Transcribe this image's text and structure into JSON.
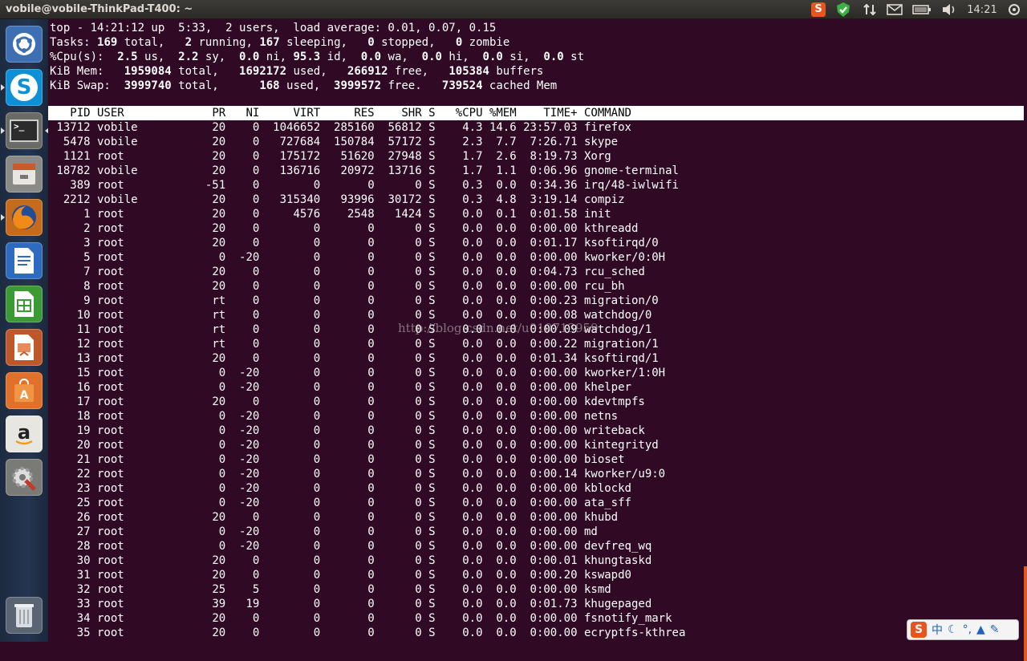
{
  "window": {
    "title": "vobile@vobile-ThinkPad-T400: ~"
  },
  "tray": {
    "clock": "14:21"
  },
  "launcher": {
    "items": [
      "Dash home",
      "Skype",
      "Terminal",
      "Files",
      "Firefox",
      "LibreOffice Writer",
      "LibreOffice Calc",
      "LibreOffice Impress",
      "Ubuntu Software Center",
      "Amazon",
      "System Settings",
      "Trash"
    ]
  },
  "top": {
    "line1": "top - 14:21:12 up  5:33,  2 users,  load average: 0.01, 0.07, 0.15",
    "tasks": {
      "total": "169",
      "running": "2",
      "sleeping": "167",
      "stopped": "0",
      "zombie": "0"
    },
    "cpu": {
      "us": "2.5",
      "sy": "2.2",
      "ni": "0.0",
      "id": "95.3",
      "wa": "0.0",
      "hi": "0.0",
      "si": "0.0",
      "st": "0.0"
    },
    "mem": {
      "total": "1959084",
      "used": "1692172",
      "free": "266912",
      "buffers": "105384"
    },
    "swap": {
      "total": "3999740",
      "used": "168",
      "free": "3999572",
      "cached": "739524"
    },
    "columns": [
      "PID",
      "USER",
      "PR",
      "NI",
      "VIRT",
      "RES",
      "SHR",
      "S",
      "%CPU",
      "%MEM",
      "TIME+",
      "COMMAND"
    ],
    "processes": [
      [
        "13712",
        "vobile",
        "20",
        "0",
        "1046652",
        "285160",
        "56812",
        "S",
        "4.3",
        "14.6",
        "23:57.03",
        "firefox"
      ],
      [
        "5478",
        "vobile",
        "20",
        "0",
        "727684",
        "150784",
        "57172",
        "S",
        "2.3",
        "7.7",
        "7:26.71",
        "skype"
      ],
      [
        "1121",
        "root",
        "20",
        "0",
        "175172",
        "51620",
        "27948",
        "S",
        "1.7",
        "2.6",
        "8:19.73",
        "Xorg"
      ],
      [
        "18782",
        "vobile",
        "20",
        "0",
        "136716",
        "20972",
        "13716",
        "S",
        "1.7",
        "1.1",
        "0:06.96",
        "gnome-terminal"
      ],
      [
        "389",
        "root",
        "-51",
        "0",
        "0",
        "0",
        "0",
        "S",
        "0.3",
        "0.0",
        "0:34.36",
        "irq/48-iwlwifi"
      ],
      [
        "2212",
        "vobile",
        "20",
        "0",
        "315340",
        "93996",
        "30172",
        "S",
        "0.3",
        "4.8",
        "3:19.14",
        "compiz"
      ],
      [
        "1",
        "root",
        "20",
        "0",
        "4576",
        "2548",
        "1424",
        "S",
        "0.0",
        "0.1",
        "0:01.58",
        "init"
      ],
      [
        "2",
        "root",
        "20",
        "0",
        "0",
        "0",
        "0",
        "S",
        "0.0",
        "0.0",
        "0:00.00",
        "kthreadd"
      ],
      [
        "3",
        "root",
        "20",
        "0",
        "0",
        "0",
        "0",
        "S",
        "0.0",
        "0.0",
        "0:01.17",
        "ksoftirqd/0"
      ],
      [
        "5",
        "root",
        "0",
        "-20",
        "0",
        "0",
        "0",
        "S",
        "0.0",
        "0.0",
        "0:00.00",
        "kworker/0:0H"
      ],
      [
        "7",
        "root",
        "20",
        "0",
        "0",
        "0",
        "0",
        "S",
        "0.0",
        "0.0",
        "0:04.73",
        "rcu_sched"
      ],
      [
        "8",
        "root",
        "20",
        "0",
        "0",
        "0",
        "0",
        "S",
        "0.0",
        "0.0",
        "0:00.00",
        "rcu_bh"
      ],
      [
        "9",
        "root",
        "rt",
        "0",
        "0",
        "0",
        "0",
        "S",
        "0.0",
        "0.0",
        "0:00.23",
        "migration/0"
      ],
      [
        "10",
        "root",
        "rt",
        "0",
        "0",
        "0",
        "0",
        "S",
        "0.0",
        "0.0",
        "0:00.08",
        "watchdog/0"
      ],
      [
        "11",
        "root",
        "rt",
        "0",
        "0",
        "0",
        "0",
        "S",
        "0.0",
        "0.0",
        "0:00.09",
        "watchdog/1"
      ],
      [
        "12",
        "root",
        "rt",
        "0",
        "0",
        "0",
        "0",
        "S",
        "0.0",
        "0.0",
        "0:00.22",
        "migration/1"
      ],
      [
        "13",
        "root",
        "20",
        "0",
        "0",
        "0",
        "0",
        "S",
        "0.0",
        "0.0",
        "0:01.34",
        "ksoftirqd/1"
      ],
      [
        "15",
        "root",
        "0",
        "-20",
        "0",
        "0",
        "0",
        "S",
        "0.0",
        "0.0",
        "0:00.00",
        "kworker/1:0H"
      ],
      [
        "16",
        "root",
        "0",
        "-20",
        "0",
        "0",
        "0",
        "S",
        "0.0",
        "0.0",
        "0:00.00",
        "khelper"
      ],
      [
        "17",
        "root",
        "20",
        "0",
        "0",
        "0",
        "0",
        "S",
        "0.0",
        "0.0",
        "0:00.00",
        "kdevtmpfs"
      ],
      [
        "18",
        "root",
        "0",
        "-20",
        "0",
        "0",
        "0",
        "S",
        "0.0",
        "0.0",
        "0:00.00",
        "netns"
      ],
      [
        "19",
        "root",
        "0",
        "-20",
        "0",
        "0",
        "0",
        "S",
        "0.0",
        "0.0",
        "0:00.00",
        "writeback"
      ],
      [
        "20",
        "root",
        "0",
        "-20",
        "0",
        "0",
        "0",
        "S",
        "0.0",
        "0.0",
        "0:00.00",
        "kintegrityd"
      ],
      [
        "21",
        "root",
        "0",
        "-20",
        "0",
        "0",
        "0",
        "S",
        "0.0",
        "0.0",
        "0:00.00",
        "bioset"
      ],
      [
        "22",
        "root",
        "0",
        "-20",
        "0",
        "0",
        "0",
        "S",
        "0.0",
        "0.0",
        "0:00.14",
        "kworker/u9:0"
      ],
      [
        "23",
        "root",
        "0",
        "-20",
        "0",
        "0",
        "0",
        "S",
        "0.0",
        "0.0",
        "0:00.00",
        "kblockd"
      ],
      [
        "25",
        "root",
        "0",
        "-20",
        "0",
        "0",
        "0",
        "S",
        "0.0",
        "0.0",
        "0:00.00",
        "ata_sff"
      ],
      [
        "26",
        "root",
        "20",
        "0",
        "0",
        "0",
        "0",
        "S",
        "0.0",
        "0.0",
        "0:00.00",
        "khubd"
      ],
      [
        "27",
        "root",
        "0",
        "-20",
        "0",
        "0",
        "0",
        "S",
        "0.0",
        "0.0",
        "0:00.00",
        "md"
      ],
      [
        "28",
        "root",
        "0",
        "-20",
        "0",
        "0",
        "0",
        "S",
        "0.0",
        "0.0",
        "0:00.00",
        "devfreq_wq"
      ],
      [
        "30",
        "root",
        "20",
        "0",
        "0",
        "0",
        "0",
        "S",
        "0.0",
        "0.0",
        "0:00.01",
        "khungtaskd"
      ],
      [
        "31",
        "root",
        "20",
        "0",
        "0",
        "0",
        "0",
        "S",
        "0.0",
        "0.0",
        "0:00.20",
        "kswapd0"
      ],
      [
        "32",
        "root",
        "25",
        "5",
        "0",
        "0",
        "0",
        "S",
        "0.0",
        "0.0",
        "0:00.00",
        "ksmd"
      ],
      [
        "33",
        "root",
        "39",
        "19",
        "0",
        "0",
        "0",
        "S",
        "0.0",
        "0.0",
        "0:01.73",
        "khugepaged"
      ],
      [
        "34",
        "root",
        "20",
        "0",
        "0",
        "0",
        "0",
        "S",
        "0.0",
        "0.0",
        "0:00.00",
        "fsnotify_mark"
      ],
      [
        "35",
        "root",
        "20",
        "0",
        "0",
        "0",
        "0",
        "S",
        "0.0",
        "0.0",
        "0:00.00",
        "ecryptfs-kthrea"
      ]
    ]
  },
  "watermark": "http://blog.csdn.net/u010713959",
  "ime": {
    "label": "中"
  }
}
